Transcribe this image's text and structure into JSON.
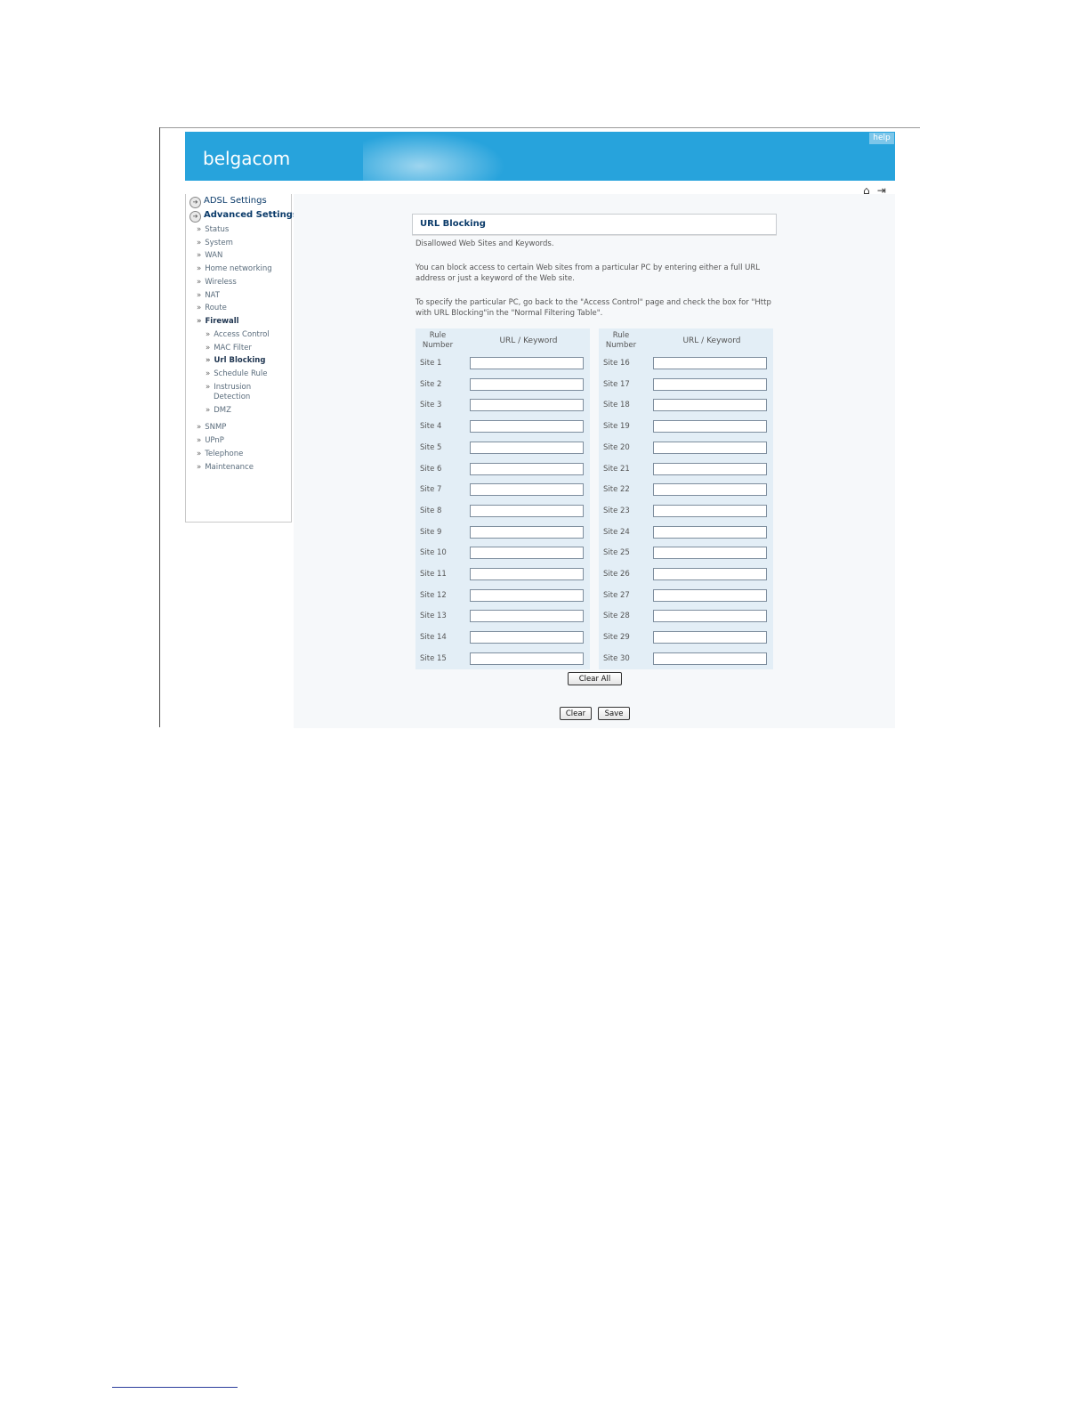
{
  "header": {
    "logo": "belgacom",
    "help": "help"
  },
  "top_icons": {
    "home": "⌂",
    "logout": "⇥"
  },
  "sidebar": {
    "main": [
      {
        "label": "ADSL Settings"
      },
      {
        "label": "Advanced Settings"
      }
    ],
    "sub": [
      {
        "label": "Status"
      },
      {
        "label": "System"
      },
      {
        "label": "WAN"
      },
      {
        "label": "Home networking"
      },
      {
        "label": "Wireless"
      },
      {
        "label": "NAT"
      },
      {
        "label": "Route"
      },
      {
        "label": "Firewall"
      },
      {
        "label": "Access Control"
      },
      {
        "label": "MAC Filter"
      },
      {
        "label": "Url Blocking"
      },
      {
        "label": "Schedule Rule"
      },
      {
        "label": "Instrusion"
      },
      {
        "label": "Detection"
      },
      {
        "label": "DMZ"
      },
      {
        "label": "SNMP"
      },
      {
        "label": "UPnP"
      },
      {
        "label": "Telephone"
      },
      {
        "label": "Maintenance"
      }
    ]
  },
  "main": {
    "title": "URL Blocking",
    "desc1": "Disallowed Web Sites and Keywords.",
    "desc2": "You can block access to certain Web sites from a particular PC by entering either a full URL address or just a keyword of the Web site.",
    "desc3": "To specify the particular PC, go back to the \"Access Control\" page and check the box for \"Http with URL Blocking\"in the \"Normal Filtering Table\".",
    "col_rule": "Rule Number",
    "col_url": "URL / Keyword",
    "sites": [
      "Site 1",
      "Site 2",
      "Site 3",
      "Site 4",
      "Site 5",
      "Site 6",
      "Site 7",
      "Site 8",
      "Site 9",
      "Site 10",
      "Site 11",
      "Site 12",
      "Site 13",
      "Site 14",
      "Site 15",
      "Site 16",
      "Site 17",
      "Site 18",
      "Site 19",
      "Site 20",
      "Site 21",
      "Site 22",
      "Site 23",
      "Site 24",
      "Site 25",
      "Site 26",
      "Site 27",
      "Site 28",
      "Site 29",
      "Site 30"
    ],
    "values": [
      "",
      "",
      "",
      "",
      "",
      "",
      "",
      "",
      "",
      "",
      "",
      "",
      "",
      "",
      "",
      "",
      "",
      "",
      "",
      "",
      "",
      "",
      "",
      "",
      "",
      "",
      "",
      "",
      "",
      ""
    ],
    "buttons": {
      "clear_all": "Clear All",
      "clear": "Clear",
      "save": "Save"
    }
  }
}
